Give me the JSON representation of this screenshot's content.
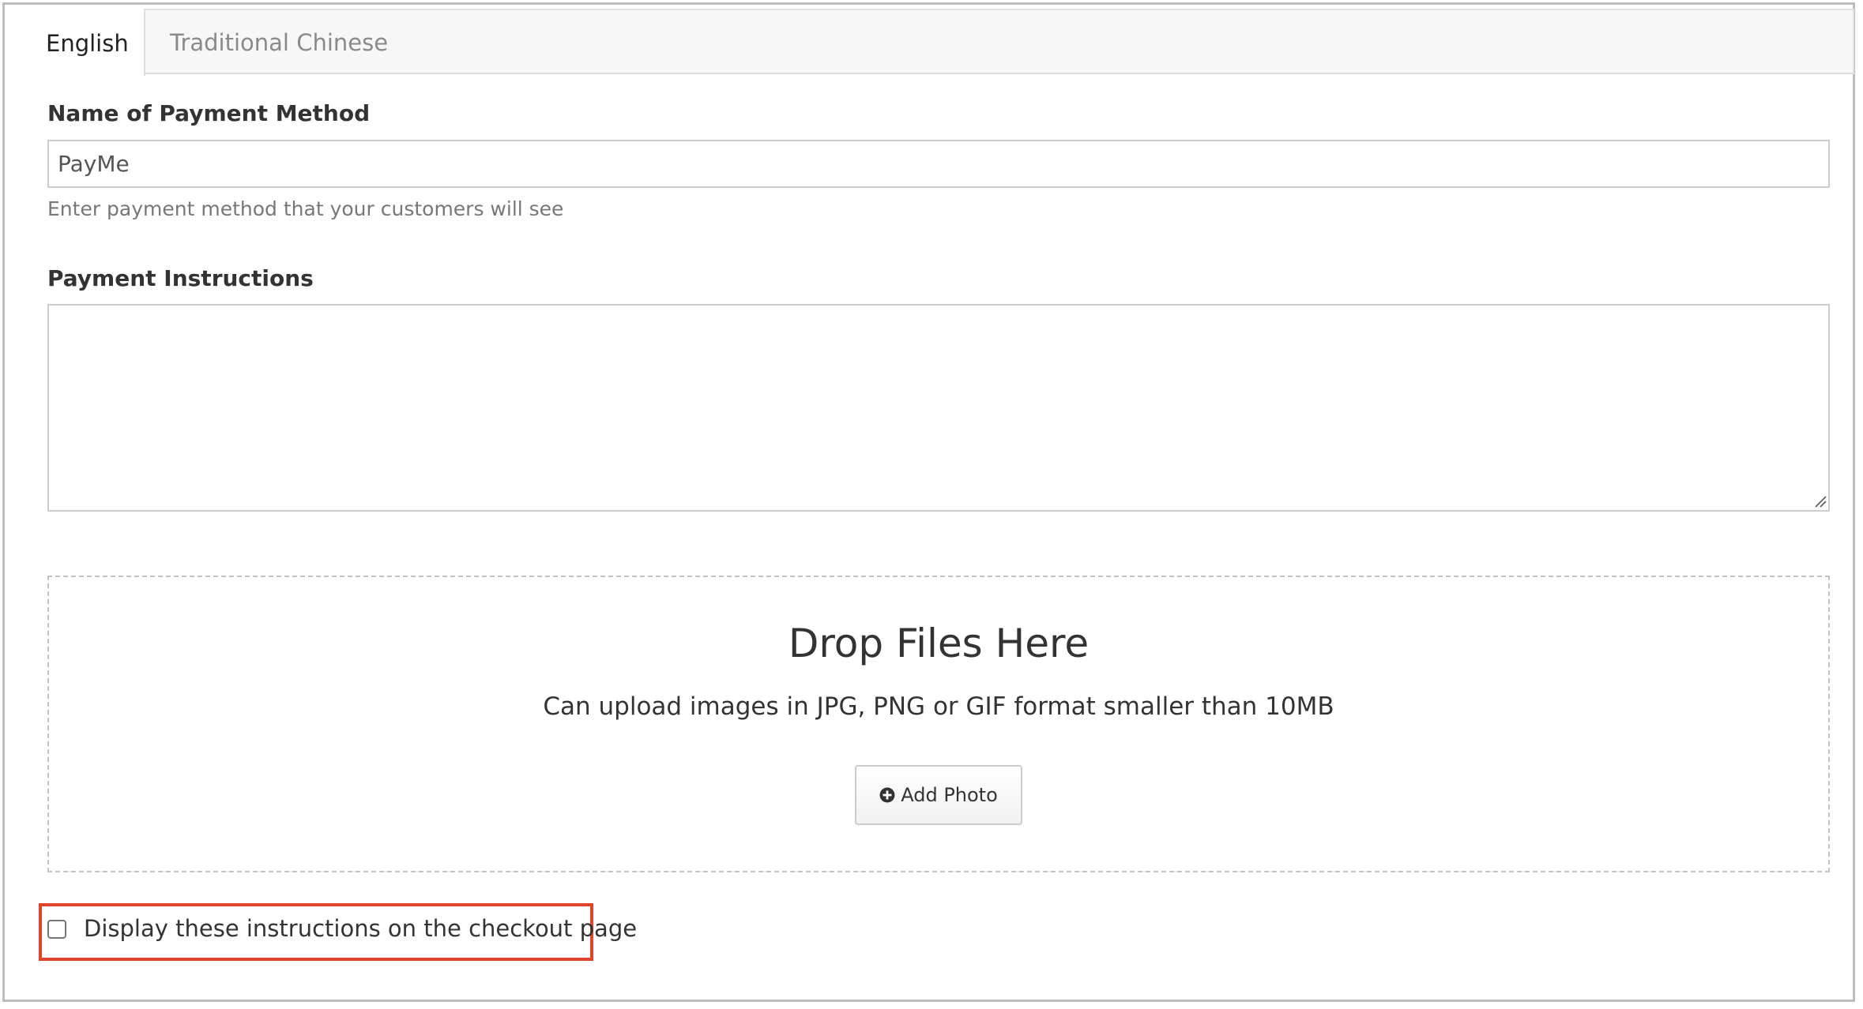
{
  "tabs": [
    {
      "label": "English",
      "active": true
    },
    {
      "label": "Traditional Chinese",
      "active": false
    }
  ],
  "payment_method": {
    "label": "Name of Payment Method",
    "value": "PayMe",
    "help": "Enter payment method that your customers will see"
  },
  "instructions": {
    "label": "Payment Instructions",
    "value": ""
  },
  "upload": {
    "title": "Drop Files Here",
    "subtitle": "Can upload images in JPG, PNG or GIF format smaller than 10MB",
    "button_label": "Add Photo",
    "button_icon": "plus-circle-icon"
  },
  "checkout": {
    "checkbox_label": "Display these instructions on the checkout page",
    "checked": false
  },
  "colors": {
    "highlight": "#e0442d",
    "border": "#cccccc",
    "tab_bar_bg": "#f7f7f7"
  }
}
